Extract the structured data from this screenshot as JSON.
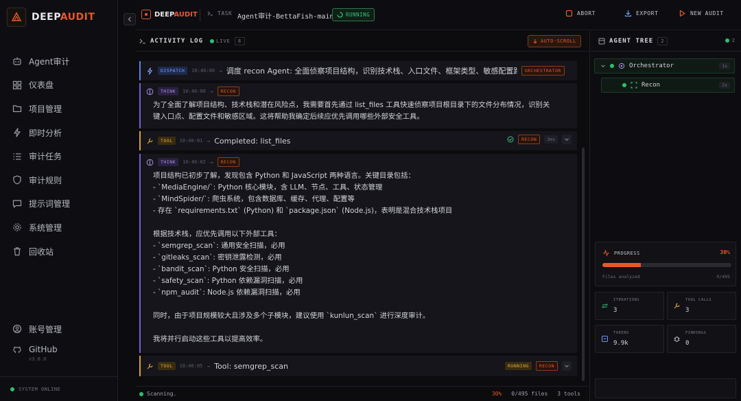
{
  "brand": {
    "name_prefix": "DEEP",
    "name_accent": "AUDIT"
  },
  "nav": [
    {
      "label": "Agent审计",
      "icon": "bot-icon"
    },
    {
      "label": "仪表盘",
      "icon": "dashboard-icon"
    },
    {
      "label": "项目管理",
      "icon": "folder-icon"
    },
    {
      "label": "即时分析",
      "icon": "lightning-icon"
    },
    {
      "label": "审计任务",
      "icon": "list-icon"
    },
    {
      "label": "审计规则",
      "icon": "shield-icon"
    },
    {
      "label": "提示词管理",
      "icon": "message-icon"
    },
    {
      "label": "系统管理",
      "icon": "gear-icon"
    },
    {
      "label": "回收站",
      "icon": "trash-icon"
    }
  ],
  "account": {
    "label": "账号管理"
  },
  "github": {
    "label": "GitHub",
    "version": "v3.0.0"
  },
  "system_status": "SYSTEM ONLINE",
  "header": {
    "brand_prefix": "DEEP",
    "brand_accent": "AUDIT",
    "task_label": "TASK",
    "task_name": "Agent审计-BettaFish-main",
    "status": "RUNNING",
    "abort": "ABORT",
    "export": "EXPORT",
    "new_audit": "NEW AUDIT"
  },
  "log": {
    "title": "ACTIVITY LOG",
    "live": "LIVE",
    "count": "8",
    "autoscroll": "AUTO-SCROLL",
    "entries": [
      {
        "type": "DISPATCH",
        "time": "10:40:00",
        "text": "调度 recon Agent: 全面侦察项目结构，识别技术栈、入口文件、框架类型、敏感配置路…",
        "agent": "ORCHESTRATOR"
      },
      {
        "type": "THINK",
        "time": "10:40:00",
        "agent": "RECON",
        "lines": [
          "为了全面了解项目结构、技术栈和潜在风险点，我需要首先通过 list_files 工具快速侦察项目根目录下的文件分布情况，识别关",
          "键入口点、配置文件和敏感区域。这将帮助我确定后续应优先调用哪些外部安全工具。"
        ]
      },
      {
        "type": "TOOL",
        "time": "10:40:01",
        "text": "Completed: list_files",
        "agent": "RECON",
        "duration": "3ms"
      },
      {
        "type": "THINK",
        "time": "10:40:02",
        "agent": "RECON",
        "lines": [
          "项目结构已初步了解，发现包含 Python 和 JavaScript 两种语言。关键目录包括：",
          "- `MediaEngine/`: Python 核心模块，含 LLM、节点、工具、状态管理",
          "- `MindSpider/`: 爬虫系统，包含数据库、缓存、代理、配置等",
          "- 存在 `requirements.txt` (Python) 和 `package.json` (Node.js)，表明是混合技术栈项目",
          "",
          "根据技术栈，应优先调用以下外部工具：",
          "- `semgrep_scan`: 通用安全扫描，必用",
          "- `gitleaks_scan`: 密钥泄露检测，必用",
          "- `bandit_scan`: Python 安全扫描，必用",
          "- `safety_scan`: Python 依赖漏洞扫描，必用",
          "- `npm_audit`: Node.js 依赖漏洞扫描，必用",
          "",
          "同时，由于项目规模较大且涉及多个子模块，建议使用 `kunlun_scan` 进行深度审计。",
          "",
          "我将并行启动这些工具以提高效率。"
        ]
      },
      {
        "type": "TOOL",
        "time": "10:40:05",
        "text": "Tool: semgrep_scan",
        "agent": "RECON",
        "state": "RUNNING"
      }
    ],
    "footer": {
      "status": "Scanning.",
      "percent": "30%",
      "files": "0/495 files",
      "tools": "3 tools"
    }
  },
  "tree": {
    "title": "AGENT TREE",
    "count": "2",
    "active": "2",
    "nodes": [
      {
        "name": "Orchestrator",
        "count": "1x"
      },
      {
        "name": "Recon",
        "count": "2x"
      }
    ]
  },
  "progress": {
    "label": "PROGRESS",
    "percent": "30%",
    "fraction": 0.3,
    "sub_label": "Files analyzed",
    "value": "0/495"
  },
  "stats": {
    "iterations": {
      "label": "ITERATIONS",
      "value": "3"
    },
    "tool_calls": {
      "label": "TOOL CALLS",
      "value": "3"
    },
    "tokens": {
      "label": "TOKENS",
      "value": "9.9k"
    },
    "findings": {
      "label": "FINDINGS",
      "value": "0"
    }
  },
  "colors": {
    "accent": "#e8572a",
    "running": "#35c57c",
    "think": "#7b5cd6",
    "dispatch": "#5a84e6",
    "tool": "#d8a23a"
  }
}
